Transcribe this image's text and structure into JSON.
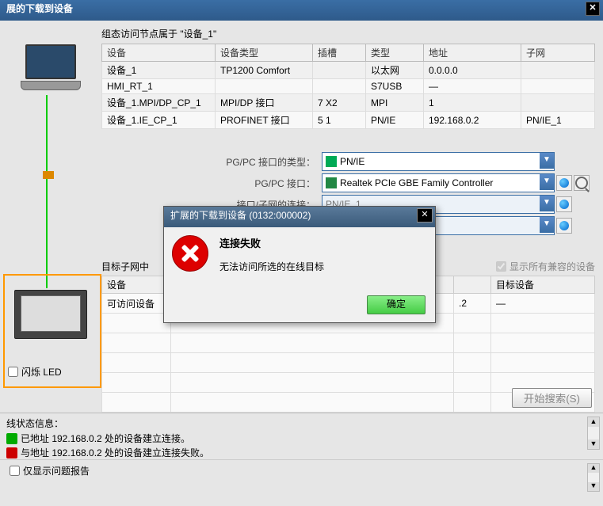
{
  "titlebar": {
    "title": "展的下载到设备"
  },
  "top": {
    "heading": "组态访问节点属于 \"设备_1\"",
    "cols": {
      "c1": "设备",
      "c2": "设备类型",
      "c3": "插槽",
      "c4": "类型",
      "c5": "地址",
      "c6": "子网"
    },
    "rows": [
      {
        "c1": "设备_1",
        "c2": "TP1200 Comfort",
        "c3": "",
        "c4": "以太网",
        "c5": "0.0.0.0",
        "c6": ""
      },
      {
        "c1": "HMI_RT_1",
        "c2": "",
        "c3": "",
        "c4": "S7USB",
        "c5": "—",
        "c6": ""
      },
      {
        "c1": "设备_1.MPI/DP_CP_1",
        "c2": "MPI/DP 接口",
        "c3": "7 X2",
        "c4": "MPI",
        "c5": "1",
        "c6": ""
      },
      {
        "c1": "设备_1.IE_CP_1",
        "c2": "PROFINET 接口",
        "c3": "5 1",
        "c4": "PN/IE",
        "c5": "192.168.0.2",
        "c6": "PN/IE_1"
      }
    ]
  },
  "form": {
    "l1": "PG/PC 接口的类型：",
    "v1": "PN/IE",
    "l2": "PG/PC 接口：",
    "v2": "Realtek PCIe GBE Family Controller",
    "l3": "接口/子网的连接：",
    "v3": "PN/IE_1"
  },
  "mid": {
    "subheader": "目标子网中",
    "compat": "显示所有兼容的设备",
    "cols": {
      "c1": "设备",
      "c5": "",
      "c6": "目标设备"
    },
    "rows": [
      {
        "c1": "可访问设备",
        "c5": ".2",
        "c6": "—"
      }
    ]
  },
  "flash": "闪烁 LED",
  "startsearch": "开始搜索(S)",
  "status": {
    "header": "线状态信息：",
    "lines": [
      {
        "kind": "ok",
        "text": "已地址 192.168.0.2 处的设备建立连接。"
      },
      {
        "kind": "err",
        "text": "与地址 192.168.0.2 处的设备建立连接失败。"
      }
    ]
  },
  "bottom": {
    "opt": "仅显示问题报告"
  },
  "modal": {
    "title": "扩展的下载到设备 (0132:000002)",
    "h": "连接失败",
    "msg": "无法访问所选的在线目标",
    "ok": "确定"
  }
}
